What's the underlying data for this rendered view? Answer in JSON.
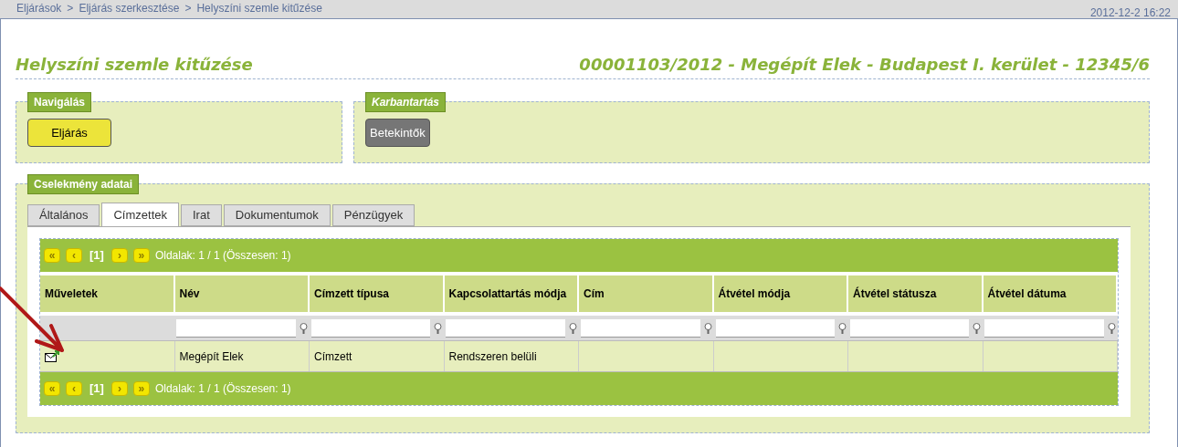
{
  "breadcrumb": [
    "Eljárások",
    "Eljárás szerkesztése",
    "Helyszíni szemle kitűzése"
  ],
  "breadcrumb_separator": ">",
  "timestamp": "2012-12-2 16:22",
  "title": "Helyszíni szemle kitűzése",
  "case_title": "00001103/2012 - Megépít Elek - Budapest I. kerület - 12345/6",
  "panels": [
    {
      "legend": "Navigálás",
      "italic": false,
      "buttons": [
        {
          "label": "Eljárás",
          "kind": "highlight"
        }
      ]
    },
    {
      "legend": "Karbantartás",
      "italic": true,
      "buttons": [
        {
          "label": "Betekintők",
          "kind": "neutral"
        }
      ]
    }
  ],
  "details": {
    "legend": "Cselekmény adatai",
    "tabs": [
      {
        "label": "Általános",
        "selected": false
      },
      {
        "label": "Címzettek",
        "selected": true
      },
      {
        "label": "Irat",
        "selected": false
      },
      {
        "label": "Dokumentumok",
        "selected": false
      },
      {
        "label": "Pénzügyek",
        "selected": false
      }
    ],
    "pager_top": {
      "first": "«",
      "prev": "‹",
      "page": "[1]",
      "next": "›",
      "last": "»",
      "summary": "Oldalak: 1 / 1 (Összesen: 1)"
    },
    "pager_bottom": {
      "first": "«",
      "prev": "‹",
      "page": "[1]",
      "next": "›",
      "last": "»",
      "summary": "Oldalak: 1 / 1 (Összesen: 1)"
    },
    "columns": [
      "Műveletek",
      "Név",
      "Címzett típusa",
      "Kapcsolattartás módja",
      "Cím",
      "Átvétel módja",
      "Átvétel státusza",
      "Átvétel dátuma"
    ],
    "rows": [
      {
        "cells": [
          "",
          "Megépít Elek",
          "Címzett",
          "Rendszeren belüli",
          "",
          "",
          "",
          ""
        ]
      }
    ]
  }
}
